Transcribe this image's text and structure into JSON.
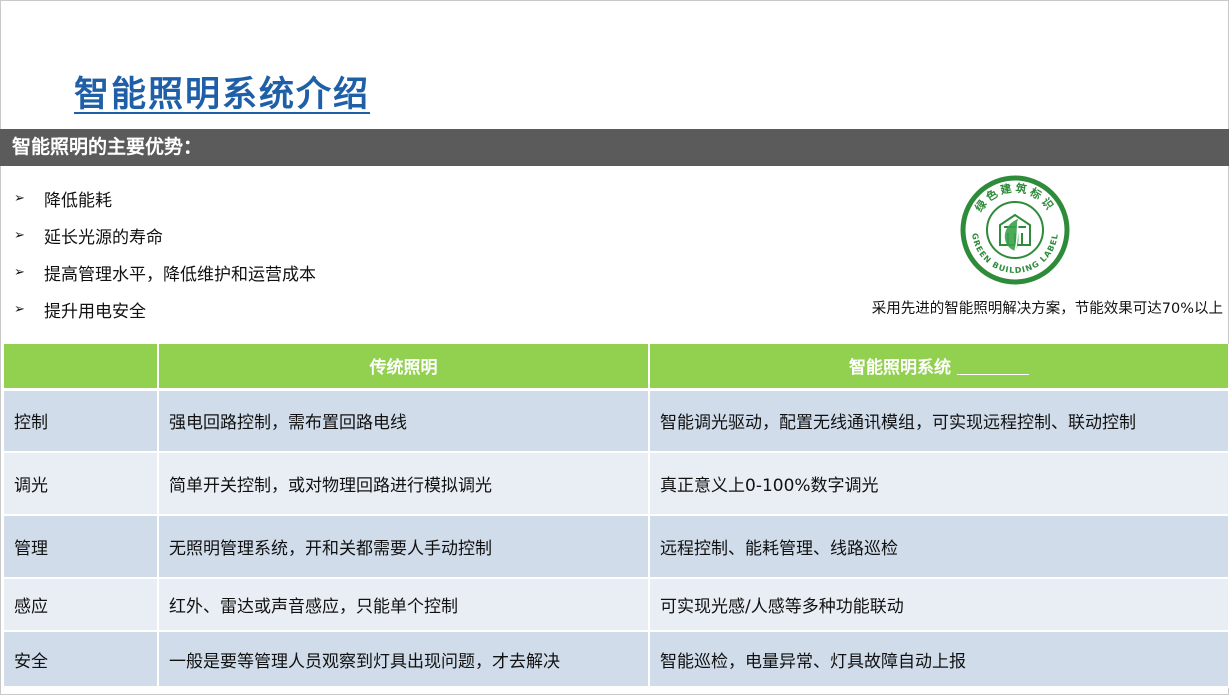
{
  "title": "智能照明系统介绍",
  "section": {
    "heading": "智能照明的主要优势："
  },
  "advantages": [
    "降低能耗",
    "延长光源的寿命",
    "提高管理水平，降低维护和运营成本",
    "提升用电安全"
  ],
  "bullet_glyph": "➢",
  "logo": {
    "top_text": "绿色建筑标识",
    "bottom_text": "GREEN BUILDING LABEL",
    "ring_color": "#2e8b3a",
    "leaf_color": "#3aa14a",
    "icon": "green-building-label-seal"
  },
  "caption": "采用先进的智能照明解决方案，节能效果可达70%以上",
  "table": {
    "headers": [
      "",
      "传统照明",
      "智能照明系统"
    ],
    "rows": [
      {
        "label": "控制",
        "traditional": "强电回路控制，需布置回路电线",
        "smart": "智能调光驱动，配置无线通讯模组，可实现远程控制、联动控制"
      },
      {
        "label": "调光",
        "traditional": "简单开关控制，或对物理回路进行模拟调光",
        "smart": "真正意义上0-100%数字调光"
      },
      {
        "label": "管理",
        "traditional": "无照明管理系统，开和关都需要人手动控制",
        "smart": "远程控制、能耗管理、线路巡检"
      },
      {
        "label": "感应",
        "traditional": "红外、雷达或声音感应，只能单个控制",
        "smart": "可实现光感/人感等多种功能联动"
      },
      {
        "label": "安全",
        "traditional": "一般是要等管理人员观察到灯具出现问题，才去解决",
        "smart": "智能巡检，电量异常、灯具故障自动上报"
      }
    ]
  },
  "colors": {
    "title": "#1f5fa8",
    "section_bar": "#5b5b5b",
    "table_header": "#92d050",
    "row_dark": "#d0dcea",
    "row_light": "#e9eef5"
  }
}
